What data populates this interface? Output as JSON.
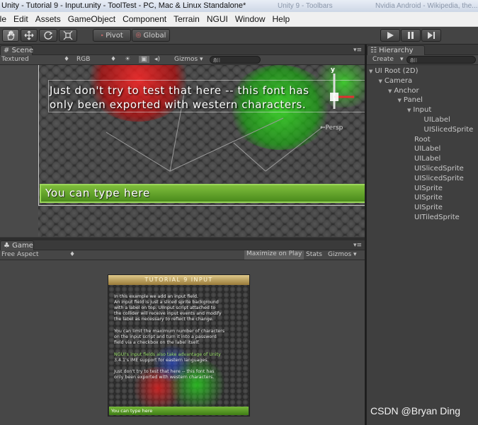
{
  "window": {
    "title": "Unity - Tutorial 9 - Input.unity - ToolTest - PC, Mac & Linux Standalone*",
    "background_tabs": [
      "Unity 9 - Toolbars",
      "Nvidia Android - Wikipedia, the..."
    ]
  },
  "menubar": {
    "items": [
      "ile",
      "Edit",
      "Assets",
      "GameObject",
      "Component",
      "Terrain",
      "NGUI",
      "Window",
      "Help"
    ]
  },
  "toolbar": {
    "tools": [
      "hand-icon",
      "move-icon",
      "rotate-icon",
      "scale-icon"
    ],
    "pivot_label": "Pivot",
    "global_label": "Global",
    "play_controls": [
      "play-icon",
      "pause-icon",
      "step-icon"
    ]
  },
  "scene": {
    "tab_label": "Scene",
    "render_mode": "Textured",
    "color_mode": "RGB",
    "gizmos_label": "Gizmos",
    "search_placeholder": "All",
    "line1": "Just don't try to test that here -- this font has",
    "line2": "only been exported with western characters.",
    "input_text": "You can type here",
    "persp_label": "Persp",
    "axis_y": "y"
  },
  "game": {
    "tab_label": "Game",
    "aspect_label": "Free Aspect",
    "maximize_label": "Maximize on Play",
    "stats_label": "Stats",
    "gizmos_label": "Gizmos",
    "title": "TUTORIAL 9 INPUT",
    "paragraph1": [
      "In this example we add an input field.",
      "An input field is just a sliced sprite background",
      "with a label on top. UIInput script attached to",
      "the collider will receive input events and modify",
      "the label as necessary to reflect the change."
    ],
    "paragraph2": [
      "You can limit the maximum number of characters",
      "on the input script and turn it into a password",
      "field via a checkbox on the label itself."
    ],
    "paragraph3": [
      "NGUI's input fields also take advantage of Unity",
      "3.4.1's IME support for eastern languages."
    ],
    "paragraph4": [
      "Just don't try to test that here -- this font has",
      "only been exported with western characters."
    ],
    "input_text": "You can type here"
  },
  "hierarchy": {
    "tab_label": "Hierarchy",
    "create_label": "Create",
    "search_placeholder": "All",
    "items": [
      {
        "label": "UI Root (2D)",
        "indent": 0,
        "expanded": true
      },
      {
        "label": "Camera",
        "indent": 1,
        "expanded": true
      },
      {
        "label": "Anchor",
        "indent": 2,
        "expanded": true
      },
      {
        "label": "Panel",
        "indent": 3,
        "expanded": true
      },
      {
        "label": "Input",
        "indent": 4,
        "expanded": true
      },
      {
        "label": "UILabel",
        "indent": 5,
        "expanded": null
      },
      {
        "label": "UISlicedSprite",
        "indent": 5,
        "expanded": null
      },
      {
        "label": "Root",
        "indent": 4,
        "expanded": null
      },
      {
        "label": "UILabel",
        "indent": 4,
        "expanded": null
      },
      {
        "label": "UILabel",
        "indent": 4,
        "expanded": null
      },
      {
        "label": "UISlicedSprite",
        "indent": 4,
        "expanded": null
      },
      {
        "label": "UISlicedSprite",
        "indent": 4,
        "expanded": null
      },
      {
        "label": "UISprite",
        "indent": 4,
        "expanded": null
      },
      {
        "label": "UISprite",
        "indent": 4,
        "expanded": null
      },
      {
        "label": "UISprite",
        "indent": 4,
        "expanded": null
      },
      {
        "label": "UITiledSprite",
        "indent": 4,
        "expanded": null
      }
    ]
  },
  "watermark": "CSDN @Bryan Ding"
}
